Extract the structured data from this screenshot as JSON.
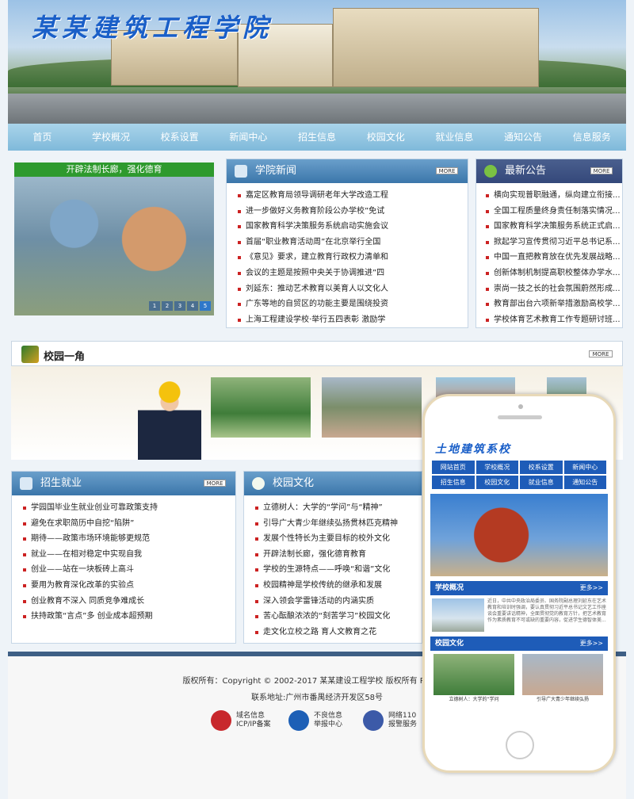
{
  "header": {
    "school_title": "某某建筑工程学院"
  },
  "nav": [
    "首页",
    "学校概况",
    "校系设置",
    "新闻中心",
    "招生信息",
    "校园文化",
    "就业信息",
    "通知公告",
    "信息服务"
  ],
  "slider": {
    "caption": "开辟法制长廊，强化德育",
    "pages": [
      "1",
      "2",
      "3",
      "4",
      "5"
    ]
  },
  "news": {
    "title": "学院新闻",
    "more": "MORE",
    "items": [
      "嘉定区教育局领导调研老年大学改造工程",
      "进一步做好义务教育阶段公办学校”免试",
      "国家教育科学决策服务系统启动实施会议",
      "首届“职业教育活动周”在北京举行全国",
      "《意见》要求，建立教育行政权力清单和",
      "会议的主题是按照中央关于协调推进”四",
      "刘延东：推动艺术教育以美育人以文化人",
      "广东等地的自贸区的功能主要是围绕投资",
      "上海工程建设学校·举行五四表彰 激励学"
    ]
  },
  "notices": {
    "title": "最新公告",
    "more": "MORE",
    "items": [
      "横向实现普职融通，纵向建立衔接...",
      "全国工程质量终身责任制落实情况...",
      "国家教育科学决策服务系统正式启...",
      "掀起学习宣传贯彻习近平总书记系...",
      "中国一直把教育放在优先发展战略...",
      "创新体制机制提高职校整体办学水...",
      "崇尚一技之长的社会氛围蔚然形成...",
      "教育部出台六项新举措激励高校学...",
      "学校体育艺术教育工作专题研讨班..."
    ]
  },
  "campus_corner": {
    "title": "校园一角",
    "more": "MORE"
  },
  "jobs": {
    "title": "招生就业",
    "more": "MORE",
    "items": [
      "学园国毕业生就业创业可靠政策支持",
      "避免在求职简历中自挖“陷阱”",
      "期待——政策市场环境能够更规范",
      "就业——在相对稳定中实现自我",
      "创业——站在一块板砖上高斗",
      "要用为教育深化改革的实验点",
      "创业教育不深入  同质竞争难成长",
      "扶持政策“言点”多  创业成本超预期"
    ]
  },
  "culture": {
    "title": "校园文化",
    "more": "MORE",
    "items": [
      "立德树人：大学的“学问”与“精神”",
      "引导广大青少年继续弘扬贯林匹克精神",
      "发展个性特长为主要目标的校外文化",
      "开辟法制长廊，强化德育教育",
      "学校的生源特点——呼唤“和谐”文化",
      "校园精神是学校传统的继承和发展",
      "深入领会学雷锋活动的内涵实质",
      "苦心酝酿浓浓的“刻苦学习”校园文化",
      "走文化立校之路 育人文教育之花"
    ]
  },
  "footer": {
    "copyright": "版权所有：Copyright © 2002-2017 某某建设工程学校 版权所有 Power b",
    "address": "联系地址:广州市番禺经济开发区58号",
    "badges": [
      {
        "line1": "域名信息",
        "line2": "ICP/IP备案",
        "color": "#c8282c"
      },
      {
        "line1": "不良信息",
        "line2": "举报中心",
        "color": "#1d5fb6"
      },
      {
        "line1": "网络110",
        "line2": "报警服务",
        "color": "#3c5aa8"
      }
    ]
  },
  "mobile": {
    "logo": "土地建筑系校",
    "nav": [
      "网站首页",
      "学校概况",
      "校系设置",
      "新闻中心",
      "招生信息",
      "校园文化",
      "就业信息",
      "通知公告"
    ],
    "section1": "学校概况",
    "section2": "校园文化",
    "more": "更多>>",
    "intro": "近日，中共中央政治局委员、国务院副总理刘延东在艺术教育和培训时强调，要认真贯彻习近平总书记文艺工作座谈会重要讲话精神，全面贯彻党的教育方针，把艺术教育作为素质教育不可或缺的重要内容，促进学生德智体美...",
    "captions": [
      "立德树人：大学的“学问",
      "引导广大青少年继续弘扬"
    ]
  }
}
